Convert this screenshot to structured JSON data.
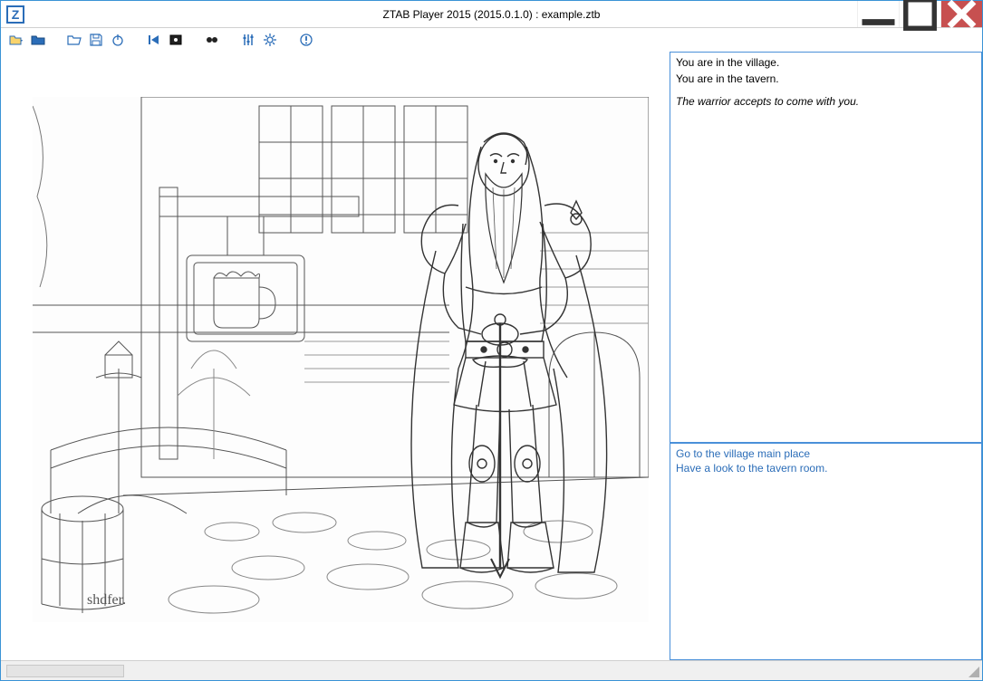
{
  "window": {
    "title": "ZTAB Player 2015 (2015.0.1.0) : example.ztb",
    "app_icon_letter": "Z"
  },
  "toolbar": {
    "icons": [
      "open-dropdown-icon",
      "open-icon",
      "sep",
      "open-folder-icon",
      "save-icon",
      "power-icon",
      "sep",
      "rewind-icon",
      "goto-icon",
      "sep",
      "eye-icon",
      "sep",
      "sliders-icon",
      "gear-icon",
      "sep",
      "info-icon"
    ]
  },
  "story": {
    "lines": [
      {
        "text": "You are in the village.",
        "italic": false
      },
      {
        "text": "You are in the tavern.",
        "italic": false
      }
    ],
    "event": "The warrior accepts to come with you."
  },
  "choices": [
    "Go to the village main place",
    "Have a look to the tavern room."
  ],
  "illustration": {
    "description": "black-and-white sketch of an armored bearded warrior with a sword in front of a medieval tavern building with a hanging mug sign, cobblestone street, bridge and lamp post",
    "signature": "shdfer."
  }
}
